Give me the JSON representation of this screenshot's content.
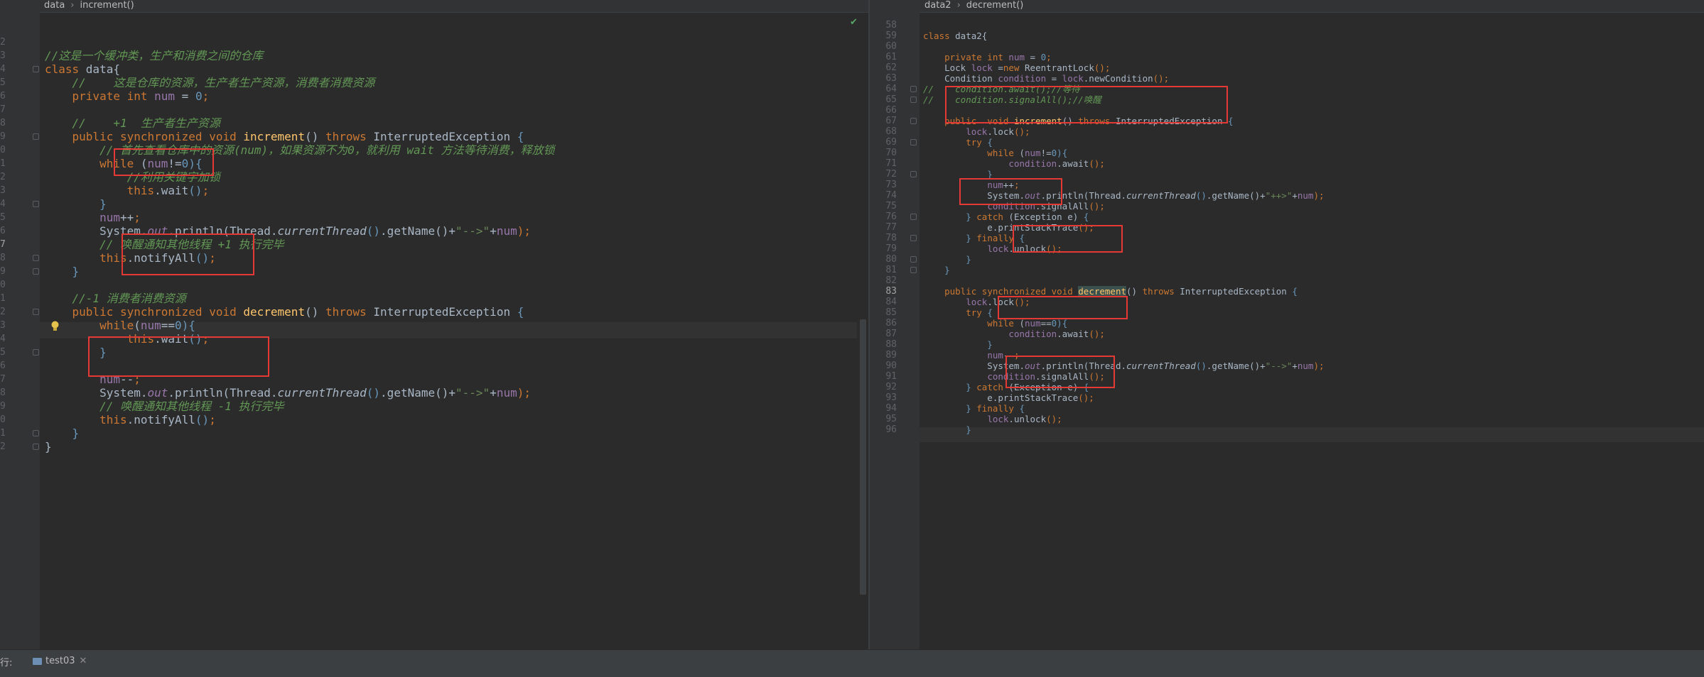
{
  "left_editor": {
    "breadcrumb": [
      "data",
      "increment()"
    ],
    "line_numbers": [
      "2",
      "3",
      "4",
      "5",
      "6",
      "7",
      "8",
      "9",
      "0",
      "1",
      "2",
      "3",
      "4",
      "5",
      "6",
      "7",
      "8",
      "9",
      "0",
      "1",
      "2",
      "3",
      "4",
      "5",
      "6",
      "7",
      "8",
      "9",
      "0",
      "1",
      "2"
    ],
    "current_line_number": "7",
    "lines": [
      [],
      [
        {
          "t": "//这是一个缓冲类，生产和消费之间的仓库",
          "c": "cm"
        }
      ],
      [
        {
          "t": "class ",
          "c": "kw"
        },
        {
          "t": "data{"
        }
      ],
      [
        {
          "t": "    //    这是仓库的资源，生产者生产资源，消费者消费资源",
          "c": "cm"
        }
      ],
      [
        {
          "t": "    private int ",
          "c": "kw"
        },
        {
          "t": "num",
          "c": "fld"
        },
        {
          "t": " = "
        },
        {
          "t": "0",
          "c": "num"
        },
        {
          "t": ";",
          "c": "kw"
        }
      ],
      [],
      [
        {
          "t": "    //    +1  生产者生产资源",
          "c": "cm"
        }
      ],
      [
        {
          "t": "    public ",
          "c": "kw"
        },
        {
          "t": "synchronized ",
          "c": "kw"
        },
        {
          "t": "void ",
          "c": "kw"
        },
        {
          "t": "increment",
          "c": "fn"
        },
        {
          "t": "() "
        },
        {
          "t": "throws ",
          "c": "kw"
        },
        {
          "t": "InterruptedException "
        },
        {
          "t": "{",
          "c": "par"
        }
      ],
      [
        {
          "t": "        // 首先查看仓库中的资源(num)，如果资源不为0，就利用 wait 方法等待消费，释放锁",
          "c": "cm"
        }
      ],
      [
        {
          "t": "        while ",
          "c": "kw"
        },
        {
          "t": "("
        },
        {
          "t": "num",
          "c": "fld"
        },
        {
          "t": "!="
        },
        {
          "t": "0",
          "c": "num"
        },
        {
          "t": "){",
          "c": "par"
        }
      ],
      [
        {
          "t": "            //利用关键字加锁",
          "c": "cm"
        }
      ],
      [
        {
          "t": "            this",
          "c": "kw"
        },
        {
          "t": ".wait"
        },
        {
          "t": "()",
          "c": "par"
        },
        {
          "t": ";",
          "c": "kw"
        }
      ],
      [
        {
          "t": "        }",
          "c": "par"
        }
      ],
      [
        {
          "t": "        "
        },
        {
          "t": "num",
          "c": "fld"
        },
        {
          "t": "++"
        },
        {
          "t": ";",
          "c": "kw"
        }
      ],
      [
        {
          "t": "        System."
        },
        {
          "t": "out",
          "c": "fldi"
        },
        {
          "t": ".println("
        },
        {
          "t": "Thread."
        },
        {
          "t": "currentThread",
          "c": "st"
        },
        {
          "t": "()",
          "c": "par"
        },
        {
          "t": ".getName()+"
        },
        {
          "t": "\"-->\"",
          "c": "str"
        },
        {
          "t": "+"
        },
        {
          "t": "num",
          "c": "fld"
        },
        {
          "t": ");",
          "c": "kw"
        }
      ],
      [
        {
          "t": "        // 唤醒通知其他线程 +1 执行完毕",
          "c": "cm"
        }
      ],
      [
        {
          "t": "        this",
          "c": "kw"
        },
        {
          "t": ".notifyAll"
        },
        {
          "t": "()",
          "c": "par"
        },
        {
          "t": ";",
          "c": "kw"
        }
      ],
      [
        {
          "t": "    }",
          "c": "par"
        }
      ],
      [],
      [
        {
          "t": "    //-1 消费者消费资源",
          "c": "cm"
        }
      ],
      [
        {
          "t": "    public ",
          "c": "kw"
        },
        {
          "t": "synchronized ",
          "c": "kw"
        },
        {
          "t": "void ",
          "c": "kw"
        },
        {
          "t": "decrement",
          "c": "fn"
        },
        {
          "t": "() "
        },
        {
          "t": "throws ",
          "c": "kw"
        },
        {
          "t": "InterruptedException "
        },
        {
          "t": "{",
          "c": "par"
        }
      ],
      [
        {
          "t": "        while",
          "c": "kw"
        },
        {
          "t": "("
        },
        {
          "t": "num",
          "c": "fld"
        },
        {
          "t": "=="
        },
        {
          "t": "0",
          "c": "num"
        },
        {
          "t": "){",
          "c": "par"
        }
      ],
      [
        {
          "t": "            this",
          "c": "kw"
        },
        {
          "t": ".wait"
        },
        {
          "t": "()",
          "c": "par"
        },
        {
          "t": ";",
          "c": "kw"
        }
      ],
      [
        {
          "t": "        }",
          "c": "par"
        }
      ],
      [],
      [
        {
          "t": "        "
        },
        {
          "t": "num",
          "c": "fld"
        },
        {
          "t": "--"
        },
        {
          "t": ";",
          "c": "kw"
        }
      ],
      [
        {
          "t": "        System."
        },
        {
          "t": "out",
          "c": "fldi"
        },
        {
          "t": ".println("
        },
        {
          "t": "Thread."
        },
        {
          "t": "currentThread",
          "c": "st"
        },
        {
          "t": "()",
          "c": "par"
        },
        {
          "t": ".getName()+"
        },
        {
          "t": "\"-->\"",
          "c": "str"
        },
        {
          "t": "+"
        },
        {
          "t": "num",
          "c": "fld"
        },
        {
          "t": ");",
          "c": "kw"
        }
      ],
      [
        {
          "t": "        // 唤醒通知其他线程 -1 执行完毕",
          "c": "cm"
        }
      ],
      [
        {
          "t": "        this",
          "c": "kw"
        },
        {
          "t": ".notifyAll"
        },
        {
          "t": "()",
          "c": "par"
        },
        {
          "t": ";",
          "c": "kw"
        }
      ],
      [
        {
          "t": "    }",
          "c": "par"
        }
      ],
      [
        {
          "t": "}"
        }
      ]
    ],
    "status_icon": "check-icon",
    "hint_icon": "lightbulb-icon"
  },
  "right_editor": {
    "breadcrumb": [
      "data2",
      "decrement()"
    ],
    "line_numbers": [
      "58",
      "59",
      "60",
      "61",
      "62",
      "63",
      "64",
      "65",
      "66",
      "67",
      "68",
      "69",
      "70",
      "71",
      "72",
      "73",
      "74",
      "75",
      "76",
      "77",
      "78",
      "79",
      "80",
      "81",
      "82",
      "83",
      "84",
      "85",
      "86",
      "87",
      "88",
      "89",
      "90",
      "91",
      "92",
      "93",
      "94",
      "95",
      "96"
    ],
    "current_line_number": "83",
    "lines": [
      [],
      [
        {
          "t": "class ",
          "c": "kw"
        },
        {
          "t": "data2{"
        }
      ],
      [],
      [
        {
          "t": "    private int ",
          "c": "kw"
        },
        {
          "t": "num",
          "c": "fld"
        },
        {
          "t": " = "
        },
        {
          "t": "0",
          "c": "num"
        },
        {
          "t": ";",
          "c": "kw"
        }
      ],
      [
        {
          "t": "    Lock "
        },
        {
          "t": "lock",
          "c": "fld"
        },
        {
          "t": " ="
        },
        {
          "t": "new ",
          "c": "kw"
        },
        {
          "t": "ReentrantLock"
        },
        {
          "t": "();",
          "c": "kw"
        }
      ],
      [
        {
          "t": "    Condition "
        },
        {
          "t": "condition",
          "c": "fld"
        },
        {
          "t": " = "
        },
        {
          "t": "lock",
          "c": "fld"
        },
        {
          "t": ".newCondition"
        },
        {
          "t": "();",
          "c": "kw"
        }
      ],
      [
        {
          "t": "//    condition.await();//等待",
          "c": "cm"
        }
      ],
      [
        {
          "t": "//    condition.signalAll();//唤醒",
          "c": "cm"
        }
      ],
      [],
      [
        {
          "t": "    public  ",
          "c": "kw"
        },
        {
          "t": "void ",
          "c": "kw"
        },
        {
          "t": "increment",
          "c": "fn"
        },
        {
          "t": "() "
        },
        {
          "t": "throws ",
          "c": "kw"
        },
        {
          "t": "InterruptedException "
        },
        {
          "t": "{",
          "c": "par"
        }
      ],
      [
        {
          "t": "        "
        },
        {
          "t": "lock",
          "c": "fld"
        },
        {
          "t": ".lock"
        },
        {
          "t": "();",
          "c": "kw"
        }
      ],
      [
        {
          "t": "        try ",
          "c": "kw"
        },
        {
          "t": "{",
          "c": "par"
        }
      ],
      [
        {
          "t": "            while ",
          "c": "kw"
        },
        {
          "t": "("
        },
        {
          "t": "num",
          "c": "fld"
        },
        {
          "t": "!="
        },
        {
          "t": "0",
          "c": "num"
        },
        {
          "t": "){",
          "c": "par"
        }
      ],
      [
        {
          "t": "                "
        },
        {
          "t": "condition",
          "c": "fld"
        },
        {
          "t": ".await"
        },
        {
          "t": "();",
          "c": "kw"
        }
      ],
      [
        {
          "t": "            }",
          "c": "par"
        }
      ],
      [
        {
          "t": "            "
        },
        {
          "t": "num",
          "c": "fld"
        },
        {
          "t": "++"
        },
        {
          "t": ";",
          "c": "kw"
        }
      ],
      [
        {
          "t": "            System."
        },
        {
          "t": "out",
          "c": "fldi"
        },
        {
          "t": ".println("
        },
        {
          "t": "Thread."
        },
        {
          "t": "currentThread",
          "c": "st"
        },
        {
          "t": "()",
          "c": "par"
        },
        {
          "t": ".getName()+"
        },
        {
          "t": "\"++>\"",
          "c": "str"
        },
        {
          "t": "+"
        },
        {
          "t": "num",
          "c": "fld"
        },
        {
          "t": ");",
          "c": "kw"
        }
      ],
      [
        {
          "t": "            "
        },
        {
          "t": "condition",
          "c": "fld"
        },
        {
          "t": ".signalAll"
        },
        {
          "t": "();",
          "c": "kw"
        }
      ],
      [
        {
          "t": "        } ",
          "c": "par"
        },
        {
          "t": "catch ",
          "c": "kw"
        },
        {
          "t": "(Exception e) "
        },
        {
          "t": "{",
          "c": "par"
        }
      ],
      [
        {
          "t": "            e.printStackTrace"
        },
        {
          "t": "();",
          "c": "kw"
        }
      ],
      [
        {
          "t": "        } ",
          "c": "par"
        },
        {
          "t": "finally ",
          "c": "kw"
        },
        {
          "t": "{",
          "c": "par"
        }
      ],
      [
        {
          "t": "            "
        },
        {
          "t": "lock",
          "c": "fld"
        },
        {
          "t": ".unlock"
        },
        {
          "t": "();",
          "c": "kw"
        }
      ],
      [
        {
          "t": "        }",
          "c": "par"
        }
      ],
      [
        {
          "t": "    }",
          "c": "par"
        }
      ],
      [],
      [
        {
          "t": "    public ",
          "c": "kw"
        },
        {
          "t": "synchronized ",
          "c": "kw"
        },
        {
          "t": "void ",
          "c": "kw"
        },
        {
          "t": "decrement",
          "c": "fnhl"
        },
        {
          "t": "() "
        },
        {
          "t": "throws ",
          "c": "kw"
        },
        {
          "t": "InterruptedException "
        },
        {
          "t": "{",
          "c": "par"
        }
      ],
      [
        {
          "t": "        "
        },
        {
          "t": "lock",
          "c": "fld"
        },
        {
          "t": ".lock"
        },
        {
          "t": "();",
          "c": "kw"
        }
      ],
      [
        {
          "t": "        try ",
          "c": "kw"
        },
        {
          "t": "{",
          "c": "par"
        }
      ],
      [
        {
          "t": "            while ",
          "c": "kw"
        },
        {
          "t": "("
        },
        {
          "t": "num",
          "c": "fld"
        },
        {
          "t": "=="
        },
        {
          "t": "0",
          "c": "num"
        },
        {
          "t": "){",
          "c": "par"
        }
      ],
      [
        {
          "t": "                "
        },
        {
          "t": "condition",
          "c": "fld"
        },
        {
          "t": ".await"
        },
        {
          "t": "();",
          "c": "kw"
        }
      ],
      [
        {
          "t": "            }",
          "c": "par"
        }
      ],
      [
        {
          "t": "            "
        },
        {
          "t": "num",
          "c": "fld"
        },
        {
          "t": "--"
        },
        {
          "t": ";",
          "c": "kw"
        }
      ],
      [
        {
          "t": "            System."
        },
        {
          "t": "out",
          "c": "fldi"
        },
        {
          "t": ".println("
        },
        {
          "t": "Thread."
        },
        {
          "t": "currentThread",
          "c": "st"
        },
        {
          "t": "()",
          "c": "par"
        },
        {
          "t": ".getName()+"
        },
        {
          "t": "\"-->\"",
          "c": "str"
        },
        {
          "t": "+"
        },
        {
          "t": "num",
          "c": "fld"
        },
        {
          "t": ");",
          "c": "kw"
        }
      ],
      [
        {
          "t": "            "
        },
        {
          "t": "condition",
          "c": "fld"
        },
        {
          "t": ".signalAll"
        },
        {
          "t": "();",
          "c": "kw"
        }
      ],
      [
        {
          "t": "        } ",
          "c": "par"
        },
        {
          "t": "catch ",
          "c": "kw"
        },
        {
          "t": "(Exception e) "
        },
        {
          "t": "{",
          "c": "par"
        }
      ],
      [
        {
          "t": "            e.printStackTrace"
        },
        {
          "t": "();",
          "c": "kw"
        }
      ],
      [
        {
          "t": "        } ",
          "c": "par"
        },
        {
          "t": "finally ",
          "c": "kw"
        },
        {
          "t": "{",
          "c": "par"
        }
      ],
      [
        {
          "t": "            "
        },
        {
          "t": "lock",
          "c": "fld"
        },
        {
          "t": ".unlock"
        },
        {
          "t": "();",
          "c": "kw"
        }
      ],
      [
        {
          "t": "        }",
          "c": "par"
        }
      ]
    ]
  },
  "bottom_bar": {
    "run_label": "行:",
    "tab_label": "test03",
    "tab_icon": "java-class-icon",
    "close_icon": "close-icon",
    "output_preview": "......................................................................"
  },
  "colors": {
    "background": "#2b2b2b",
    "keyword": "#cc7832",
    "comment": "#629755",
    "field": "#9876aa",
    "method": "#ffc66d",
    "annotation_box": "#e53935"
  }
}
